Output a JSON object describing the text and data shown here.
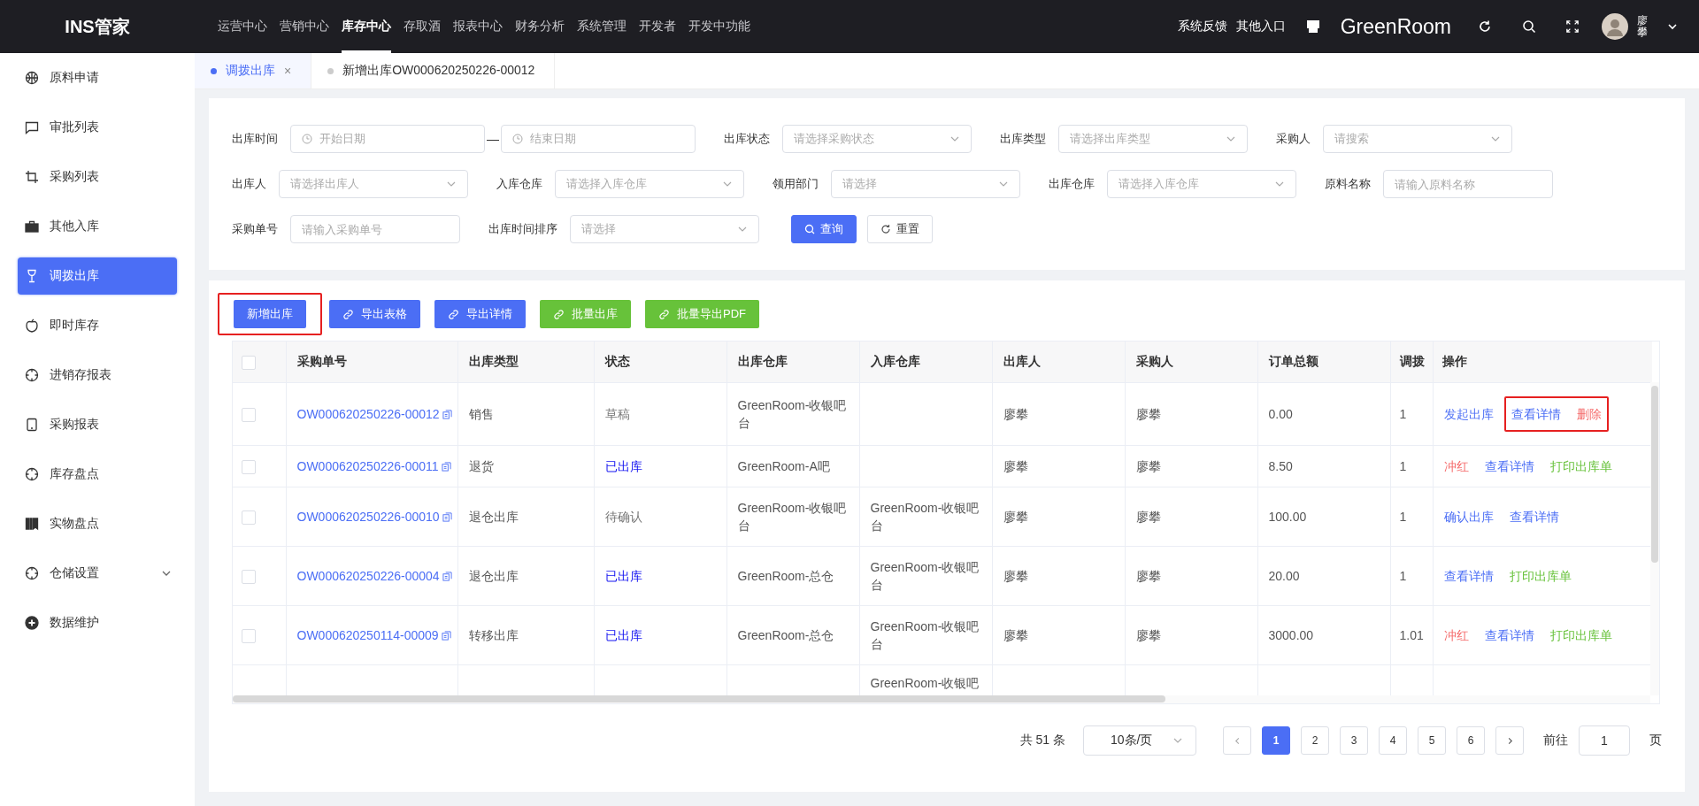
{
  "app": {
    "logo": "INS管家"
  },
  "nav": [
    {
      "label": "运营中心",
      "selected": false
    },
    {
      "label": "营销中心",
      "selected": false
    },
    {
      "label": "库存中心",
      "selected": true
    },
    {
      "label": "存取酒",
      "selected": false
    },
    {
      "label": "报表中心",
      "selected": false
    },
    {
      "label": "财务分析",
      "selected": false
    },
    {
      "label": "系统管理",
      "selected": false
    },
    {
      "label": "开发者",
      "selected": false
    },
    {
      "label": "开发中功能",
      "selected": false
    }
  ],
  "header_links": [
    "系统反馈",
    "其他入口"
  ],
  "store": "GreenRoom",
  "user": {
    "name": "廖攀"
  },
  "sidebar": {
    "items": [
      {
        "label": "原料申请",
        "selected": false
      },
      {
        "label": "审批列表",
        "selected": false
      },
      {
        "label": "采购列表",
        "selected": false
      },
      {
        "label": "其他入库",
        "selected": false
      },
      {
        "label": "调拨出库",
        "selected": true
      },
      {
        "label": "即时库存",
        "selected": false
      },
      {
        "label": "进销存报表",
        "selected": false
      },
      {
        "label": "采购报表",
        "selected": false
      },
      {
        "label": "库存盘点",
        "selected": false
      },
      {
        "label": "实物盘点",
        "selected": false
      },
      {
        "label": "仓储设置",
        "selected": false,
        "expanded": false
      },
      {
        "label": "数据维护",
        "selected": false
      }
    ]
  },
  "tabs": [
    {
      "label": "调拨出库",
      "selected": true,
      "close": "×"
    },
    {
      "label": "新增出库OW000620250226-00012",
      "selected": false
    }
  ],
  "filters": [
    [
      {
        "label": "出库时间",
        "kind": "date-range",
        "placeholder": "开始日期",
        "placeholder_end": "结束日期",
        "separator": "—"
      },
      {
        "label": "出库状态",
        "kind": "select",
        "placeholder": "请选择采购状态"
      },
      {
        "label": "出库类型",
        "kind": "select",
        "placeholder": "请选择出库类型"
      },
      {
        "label": "采购人",
        "kind": "select",
        "placeholder": "请搜索"
      }
    ],
    [
      {
        "label": "出库人",
        "kind": "select",
        "placeholder": "请选择出库人"
      },
      {
        "label": "入库仓库",
        "kind": "select",
        "placeholder": "请选择入库仓库"
      },
      {
        "label": "领用部门",
        "kind": "select",
        "placeholder": "请选择"
      },
      {
        "label": "出库仓库",
        "kind": "select",
        "placeholder": "请选择入库仓库"
      },
      {
        "label": "原料名称",
        "kind": "input",
        "placeholder": "请输入原料名称"
      }
    ],
    [
      {
        "label": "采购单号",
        "kind": "input",
        "placeholder": "请输入采购单号"
      },
      {
        "label": "出库时间排序",
        "kind": "select",
        "placeholder": "请选择"
      }
    ]
  ],
  "filter_buttons": [
    {
      "label": "查询",
      "kind": "primary"
    },
    {
      "label": "重置",
      "kind": "default"
    }
  ],
  "toolbar": [
    {
      "label": "新增出库",
      "kind": "primary",
      "icon": false,
      "highlighted": true
    },
    {
      "label": "导出表格",
      "kind": "primary",
      "icon": true,
      "highlighted": false
    },
    {
      "label": "导出详情",
      "kind": "primary",
      "icon": true,
      "highlighted": false
    },
    {
      "label": "批量出库",
      "kind": "success",
      "icon": true,
      "highlighted": false
    },
    {
      "label": "批量导出PDF",
      "kind": "success",
      "icon": true,
      "highlighted": false
    }
  ],
  "table": {
    "select_all_checked": false,
    "columns": [
      "采购单号",
      "出库类型",
      "状态",
      "出库仓库",
      "入库仓库",
      "出库人",
      "采购人",
      "订单总额",
      "调拨",
      "操作"
    ],
    "rows": [
      {
        "checked": false,
        "order_no": "OW000620250226-00012",
        "type": "销售",
        "status": {
          "text": "草稿",
          "kind": "draft"
        },
        "out_warehouse": "GreenRoom-收银吧台",
        "out_person": "廖攀",
        "buyer": "廖攀",
        "total": "0.00",
        "transfer": "1",
        "action_groups": [
          {
            "highlighted": false,
            "actions": [
              {
                "label": "发起出库",
                "kind": "primary"
              }
            ]
          },
          {
            "highlighted": true,
            "actions": [
              {
                "label": "查看详情",
                "kind": "primary"
              },
              {
                "label": "删除",
                "kind": "danger"
              }
            ]
          }
        ]
      },
      {
        "checked": false,
        "order_no": "OW000620250226-00011",
        "type": "退货",
        "status": {
          "text": "已出库",
          "kind": "done"
        },
        "out_warehouse": "GreenRoom-A吧",
        "out_person": "廖攀",
        "buyer": "廖攀",
        "total": "8.50",
        "transfer": "1",
        "action_groups": [
          {
            "highlighted": false,
            "actions": [
              {
                "label": "冲红",
                "kind": "danger"
              },
              {
                "label": "查看详情",
                "kind": "primary"
              },
              {
                "label": "打印出库单",
                "kind": "success"
              }
            ]
          }
        ]
      },
      {
        "checked": false,
        "order_no": "OW000620250226-00010",
        "type": "退仓出库",
        "status": {
          "text": "待确认",
          "kind": "pending"
        },
        "out_warehouse": "GreenRoom-收银吧台",
        "in_warehouse": "GreenRoom-收银吧台",
        "out_person": "廖攀",
        "buyer": "廖攀",
        "total": "100.00",
        "transfer": "1",
        "action_groups": [
          {
            "highlighted": false,
            "actions": [
              {
                "label": "确认出库",
                "kind": "primary"
              },
              {
                "label": "查看详情",
                "kind": "primary"
              }
            ]
          }
        ]
      },
      {
        "checked": false,
        "order_no": "OW000620250226-00004",
        "type": "退仓出库",
        "status": {
          "text": "已出库",
          "kind": "done"
        },
        "out_warehouse": "GreenRoom-总仓",
        "in_warehouse": "GreenRoom-收银吧台",
        "out_person": "廖攀",
        "buyer": "廖攀",
        "total": "20.00",
        "transfer": "1",
        "action_groups": [
          {
            "highlighted": false,
            "actions": [
              {
                "label": "查看详情",
                "kind": "primary"
              },
              {
                "label": "打印出库单",
                "kind": "success"
              }
            ]
          }
        ]
      },
      {
        "checked": false,
        "order_no": "OW000620250114-00009",
        "type": "转移出库",
        "status": {
          "text": "已出库",
          "kind": "done"
        },
        "out_warehouse": "GreenRoom-总仓",
        "in_warehouse": "GreenRoom-收银吧台",
        "out_person": "廖攀",
        "buyer": "廖攀",
        "total": "3000.00",
        "transfer": "1.01",
        "action_groups": [
          {
            "highlighted": false,
            "actions": [
              {
                "label": "冲红",
                "kind": "danger"
              },
              {
                "label": "查看详情",
                "kind": "primary"
              },
              {
                "label": "打印出库单",
                "kind": "success"
              }
            ]
          }
        ]
      }
    ],
    "partial_row": {
      "in_warehouse": "GreenRoom-收银吧"
    }
  },
  "pagination": {
    "total": "共 51 条",
    "page_size": "10条/页",
    "pages": [
      {
        "label": "1",
        "selected": true
      },
      {
        "label": "2",
        "selected": false
      },
      {
        "label": "3",
        "selected": false
      },
      {
        "label": "4",
        "selected": false
      },
      {
        "label": "5",
        "selected": false
      },
      {
        "label": "6",
        "selected": false
      }
    ],
    "goto_label": "前往",
    "goto_value": "1",
    "goto_suffix": "页"
  }
}
